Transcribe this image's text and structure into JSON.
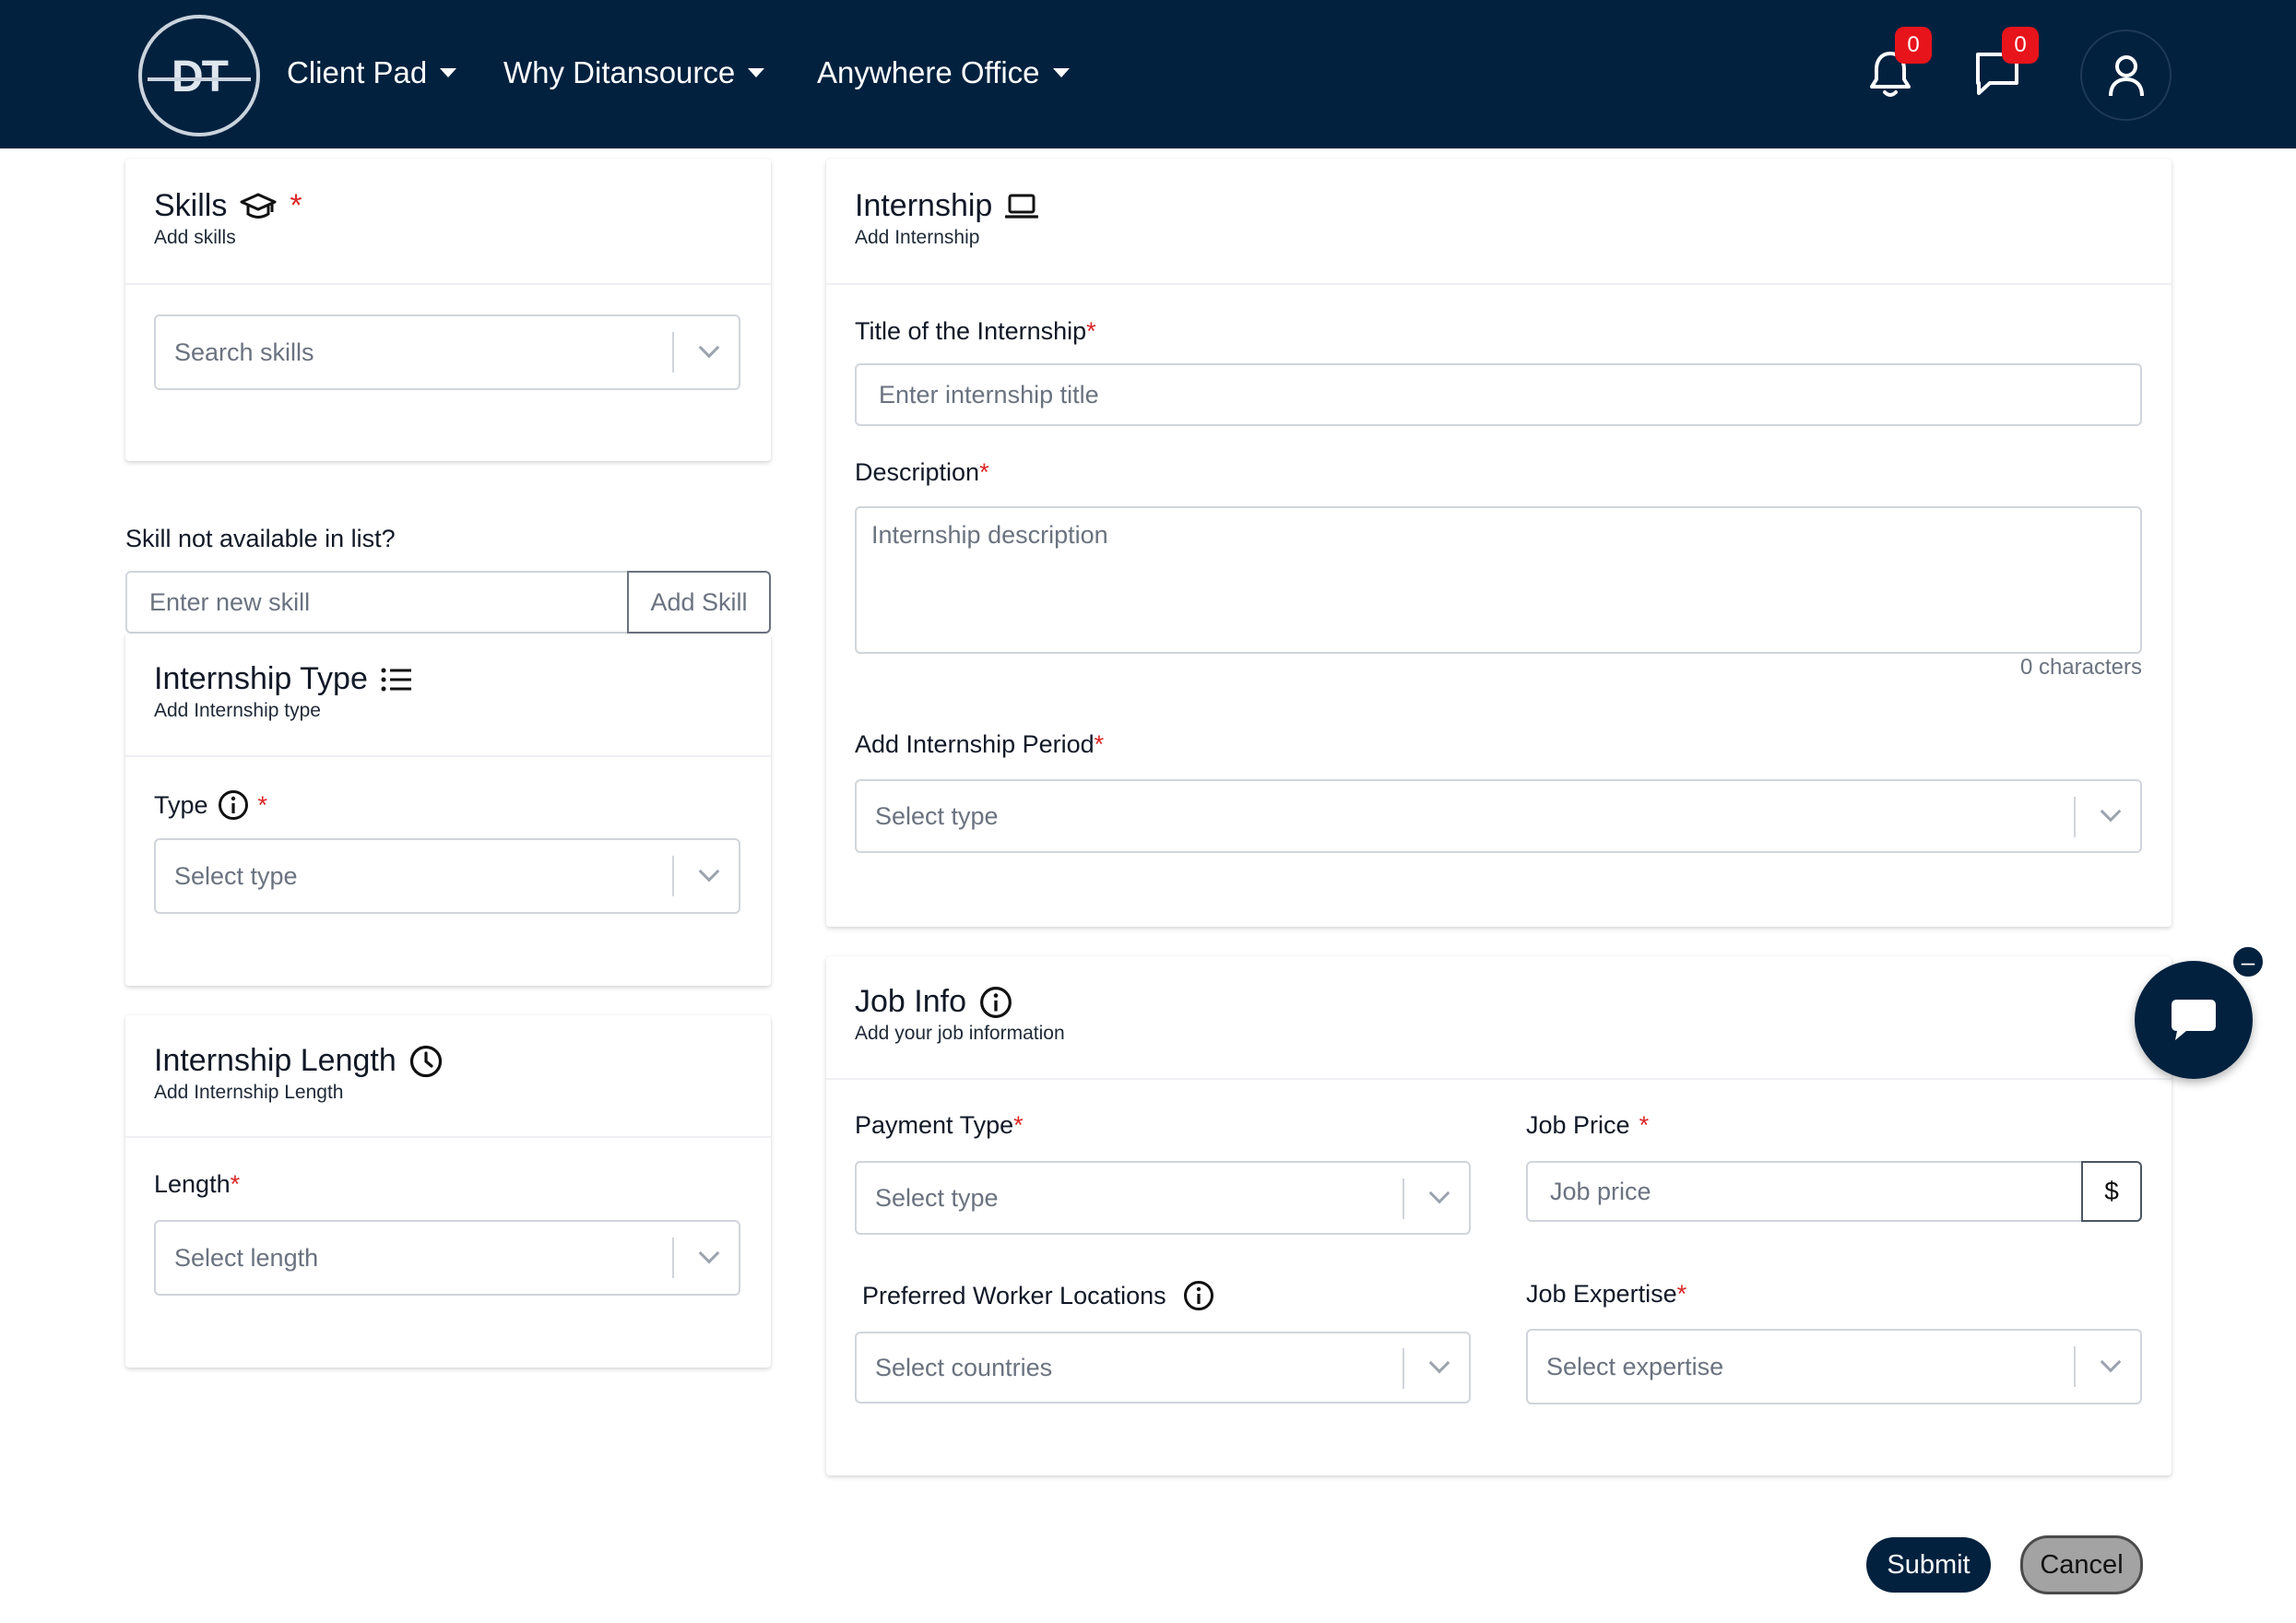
{
  "nav": {
    "logo_text": "DT",
    "items": [
      {
        "label": "Client Pad"
      },
      {
        "label": "Why Ditansource"
      },
      {
        "label": "Anywhere Office"
      }
    ],
    "notifications_count": "0",
    "messages_count": "0"
  },
  "skills": {
    "title": "Skills",
    "required_mark": "*",
    "subtitle": "Add skills",
    "search_placeholder": "Search skills",
    "not_available_label": "Skill not available in list?",
    "new_skill_placeholder": "Enter new skill",
    "add_button": "Add Skill"
  },
  "internship_type": {
    "title": "Internship Type",
    "subtitle": "Add Internship type",
    "type_label": "Type",
    "required_mark": "*",
    "select_placeholder": "Select type"
  },
  "internship_length": {
    "title": "Internship Length",
    "subtitle": "Add Internship Length",
    "length_label": "Length",
    "required_mark": "*",
    "select_placeholder": "Select length"
  },
  "internship": {
    "title": "Internship",
    "subtitle": "Add Internship",
    "title_label": "Title of the Internship",
    "title_placeholder": "Enter internship title",
    "description_label": "Description",
    "description_placeholder": "Internship description",
    "char_count": "0 characters",
    "period_label": "Add Internship Period",
    "period_placeholder": "Select type",
    "required_mark": "*"
  },
  "job_info": {
    "title": "Job Info",
    "subtitle": "Add your job information",
    "payment_type_label": "Payment Type",
    "payment_type_placeholder": "Select type",
    "job_price_label": "Job Price",
    "job_price_placeholder": "Job price",
    "currency_symbol": "$",
    "locations_label": "Preferred Worker Locations",
    "locations_placeholder": "Select countries",
    "expertise_label": "Job Expertise",
    "expertise_placeholder": "Select expertise",
    "required_mark": "*"
  },
  "actions": {
    "submit": "Submit",
    "cancel": "Cancel"
  },
  "chat": {
    "minimize_glyph": "–"
  }
}
